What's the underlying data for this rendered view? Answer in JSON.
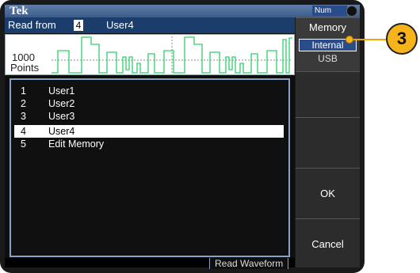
{
  "brand": "Tek",
  "num_badge": "Num",
  "header": {
    "read_from_label": "Read from",
    "selected_number": "4",
    "selected_name": "User4"
  },
  "waveform": {
    "points_value": "1000",
    "points_label": "Points",
    "trace_color": "#2fd06a"
  },
  "list": [
    {
      "index": "1",
      "name": "User1"
    },
    {
      "index": "2",
      "name": "User2"
    },
    {
      "index": "3",
      "name": "User3"
    },
    {
      "index": "4",
      "name": "User4",
      "selected": true
    },
    {
      "index": "5",
      "name": "Edit Memory"
    }
  ],
  "bottom_tab": "Read Waveform",
  "side_menu": {
    "memory_title": "Memory",
    "option_internal": "Internal",
    "option_usb": "USB",
    "selected_option": "Internal",
    "ok_label": "OK",
    "cancel_label": "Cancel"
  },
  "callout": "3",
  "colors": {
    "accent": "#2b4c8a",
    "header": "#1b3d6b",
    "callout": "#f7b31a"
  }
}
